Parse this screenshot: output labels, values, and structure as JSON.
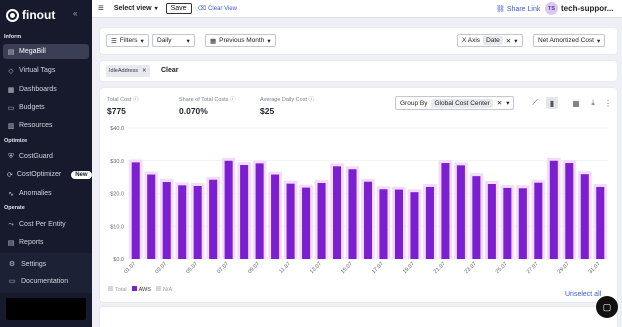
{
  "brand": {
    "logo_text": "finout"
  },
  "sidebar": {
    "sections": [
      {
        "label": "Inform",
        "items": [
          {
            "label": "MegaBill",
            "icon": "megabill-icon",
            "active": true
          },
          {
            "label": "Virtual Tags",
            "icon": "tag-icon"
          },
          {
            "label": "Dashboards",
            "icon": "dashboard-icon"
          },
          {
            "label": "Budgets",
            "icon": "budget-icon"
          },
          {
            "label": "Resources",
            "icon": "resources-icon"
          }
        ]
      },
      {
        "label": "Optimize",
        "items": [
          {
            "label": "CostGuard",
            "icon": "costguard-icon"
          },
          {
            "label": "CostOptimizer",
            "icon": "costoptimizer-icon",
            "badge": "New"
          },
          {
            "label": "Anomalies",
            "icon": "anomalies-icon"
          }
        ]
      },
      {
        "label": "Operate",
        "items": [
          {
            "label": "Cost Per Entity",
            "icon": "cost-entity-icon"
          },
          {
            "label": "Reports",
            "icon": "reports-icon"
          }
        ]
      }
    ],
    "footer": {
      "settings": "Settings",
      "documentation": "Documentation"
    }
  },
  "topbar": {
    "select_view": "Select view",
    "save": "Save",
    "clear_view": "Clear View",
    "share_link": "Share Link",
    "avatar_initials": "TS",
    "account": "tech-suppor..."
  },
  "filters": {
    "filters_btn": "Filters",
    "granularity": "Daily",
    "period": "Previous Month",
    "x_axis_label": "X Axis",
    "x_axis_value": "Date",
    "cost_type": "Net Amortized Cost"
  },
  "tags": {
    "active_tag": "IdleAddress",
    "clear": "Clear"
  },
  "kpis": [
    {
      "label": "Total Cost",
      "value": "$775"
    },
    {
      "label": "Share of Total Costs",
      "value": "0.070%"
    },
    {
      "label": "Average Daily Cost",
      "value": "$25"
    }
  ],
  "group_by": {
    "label": "Group By",
    "value": "Global Cost Center"
  },
  "legend": [
    {
      "label": "Total",
      "color": "#d8d8d8"
    },
    {
      "label": "AWS",
      "color": "#7b1fd1"
    },
    {
      "label": "N/A",
      "color": "#d8d8d8"
    }
  ],
  "unselect_all": "Unselect all",
  "colors": {
    "bar": "#7b1fd1",
    "bar_glow": "#f3dcf9",
    "link": "#3a5bdc",
    "sidebar_bg": "#161a2c"
  },
  "chart_data": {
    "type": "bar",
    "ylim": [
      0,
      40
    ],
    "yticks": [
      "$0.0",
      "$10.0",
      "$20.0",
      "$30.0",
      "$40.0"
    ],
    "categories": [
      "01.07",
      "02.07",
      "03.07",
      "04.07",
      "05.07",
      "06.07",
      "07.07",
      "08.07",
      "09.07",
      "10.07",
      "11.07",
      "12.07",
      "13.07",
      "14.07",
      "15.07",
      "16.07",
      "17.07",
      "18.07",
      "19.07",
      "20.07",
      "21.07",
      "22.07",
      "23.07",
      "24.07",
      "25.07",
      "26.07",
      "27.07",
      "28.07",
      "29.07",
      "30.07",
      "31.07"
    ],
    "xtick_labels": [
      "01.07",
      "",
      "03.07",
      "",
      "05.07",
      "",
      "07.07",
      "",
      "09.07",
      "",
      "11.07",
      "",
      "13.07",
      "",
      "15.07",
      "",
      "17.07",
      "",
      "19.07",
      "",
      "21.07",
      "",
      "23.07",
      "",
      "25.07",
      "",
      "27.07",
      "",
      "29.07",
      "",
      "31.07"
    ],
    "series": [
      {
        "name": "AWS",
        "values": [
          29.5,
          25.8,
          23.5,
          22.5,
          22.3,
          24.2,
          30.0,
          28.7,
          29.2,
          25.8,
          23.0,
          21.8,
          23.2,
          28.3,
          27.4,
          23.6,
          21.3,
          21.2,
          20.4,
          22.0,
          29.3,
          28.6,
          25.3,
          22.9,
          21.7,
          21.6,
          23.3,
          30.0,
          29.3,
          25.9,
          22.0
        ]
      }
    ]
  }
}
